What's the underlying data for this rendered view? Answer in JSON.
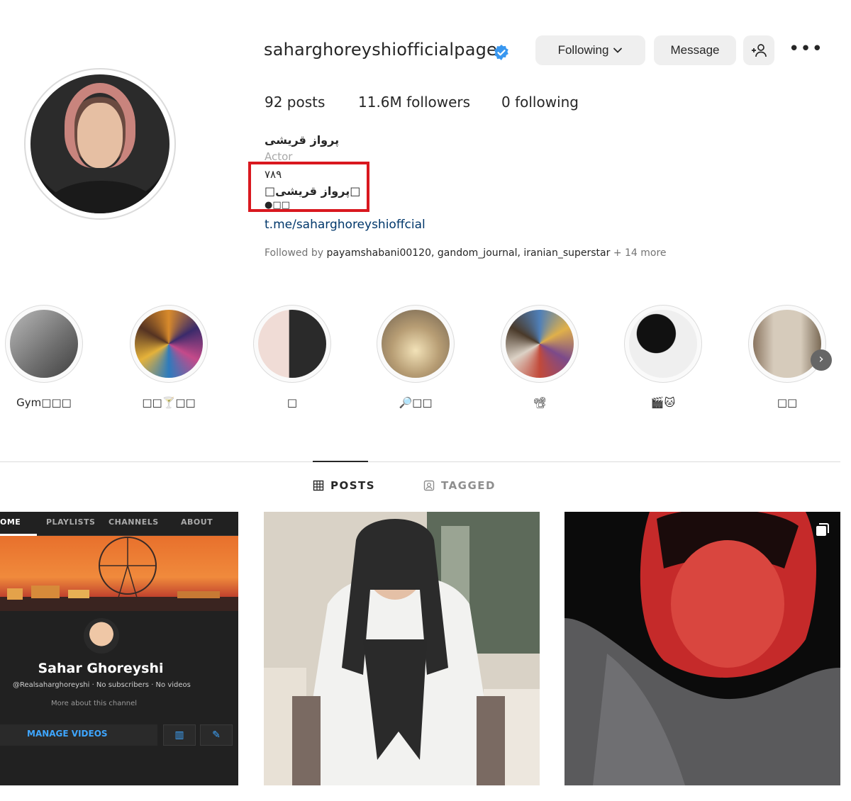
{
  "profile": {
    "username": "saharghoreyshiofficialpage",
    "verified_icon": "verified-badge-icon",
    "buttons": {
      "following": "Following",
      "message": "Message"
    },
    "stats": {
      "posts": "92 posts",
      "followers": "11.6M followers",
      "following": "0 following"
    },
    "bio": {
      "name": "پرواز قریشی",
      "category": "Actor",
      "line1": "۷۸۹",
      "line2": "□پرواز قریشی□",
      "line3": "●□□",
      "link": "t.me/saharghoreyshioffcial"
    },
    "followed_by": {
      "prefix": "Followed by",
      "names": "payamshabani00120, gandom_journal, iranian_superstar",
      "suffix": "+ 14 more"
    }
  },
  "highlights": [
    {
      "label": "Gym□□□"
    },
    {
      "label": "□□🍸□□"
    },
    {
      "label": "□"
    },
    {
      "label": "🔎□□"
    },
    {
      "label": "📽"
    },
    {
      "label": "🎬🐱"
    },
    {
      "label": "□□"
    }
  ],
  "tabs": {
    "posts": "POSTS",
    "tagged": "TAGGED"
  },
  "post1": {
    "tabs": [
      "OME",
      "PLAYLISTS",
      "CHANNELS",
      "ABOUT"
    ],
    "channel_name": "Sahar Ghoreyshi",
    "meta": "@Realsaharghoreyshi · No subscribers · No videos",
    "more": "More about this channel",
    "manage": "MANAGE VIDEOS"
  },
  "colors": {
    "accent_link": "#00376b",
    "highlight_box": "#d9181f",
    "verified": "#3897f0",
    "youtube_blue": "#3ea6ff"
  }
}
